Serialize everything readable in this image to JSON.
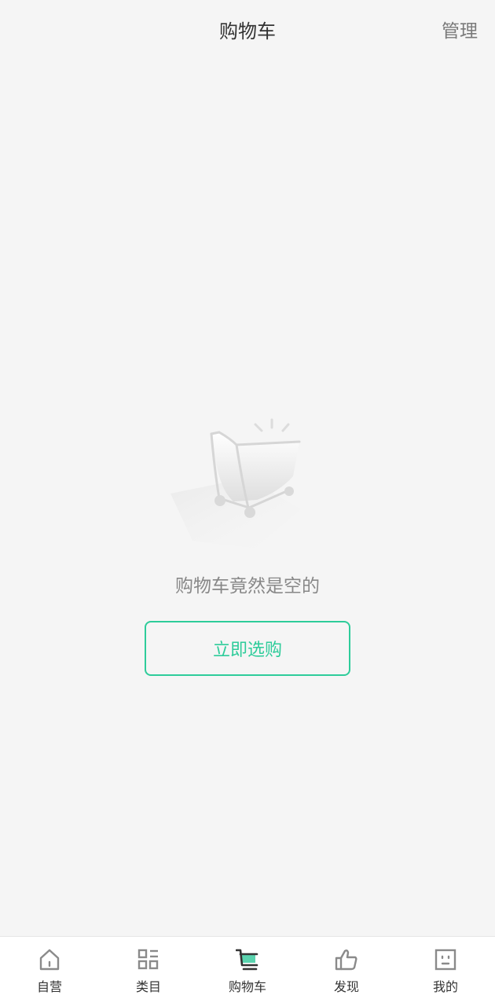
{
  "header": {
    "title": "购物车",
    "manage_label": "管理"
  },
  "empty_state": {
    "illustration_icon": "empty-cart-icon",
    "message": "购物车竟然是空的",
    "button_label": "立即选购"
  },
  "colors": {
    "accent": "#2ecc9a",
    "background": "#f5f5f5",
    "icon_gray": "#8a8a8a",
    "active_icon": "#333333"
  },
  "tabbar": {
    "items": [
      {
        "label": "自营",
        "icon": "home-icon",
        "active": false
      },
      {
        "label": "类目",
        "icon": "category-icon",
        "active": false
      },
      {
        "label": "购物车",
        "icon": "cart-icon",
        "active": true
      },
      {
        "label": "发现",
        "icon": "thumbs-up-icon",
        "active": false
      },
      {
        "label": "我的",
        "icon": "profile-icon",
        "active": false
      }
    ]
  }
}
